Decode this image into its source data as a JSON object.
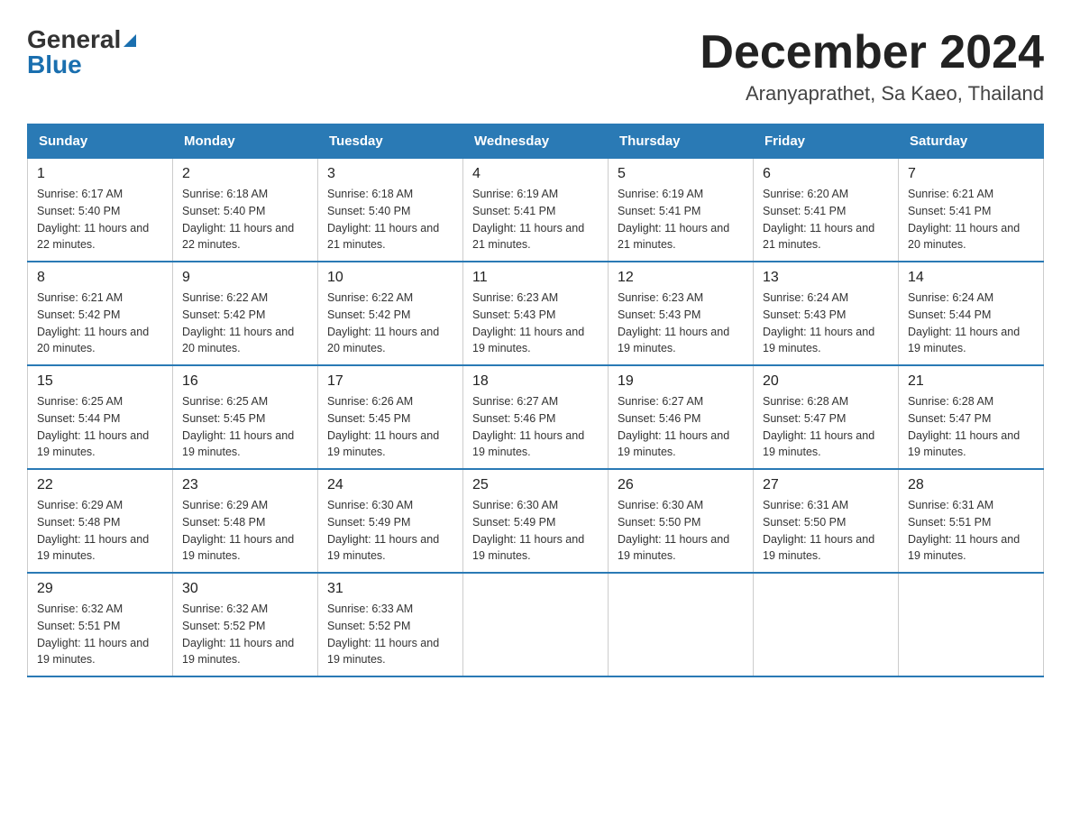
{
  "logo": {
    "general": "General",
    "blue": "Blue"
  },
  "header": {
    "title": "December 2024",
    "subtitle": "Aranyaprathet, Sa Kaeo, Thailand"
  },
  "days_of_week": [
    "Sunday",
    "Monday",
    "Tuesday",
    "Wednesday",
    "Thursday",
    "Friday",
    "Saturday"
  ],
  "weeks": [
    [
      {
        "day": "1",
        "sunrise": "6:17 AM",
        "sunset": "5:40 PM",
        "daylight": "11 hours and 22 minutes."
      },
      {
        "day": "2",
        "sunrise": "6:18 AM",
        "sunset": "5:40 PM",
        "daylight": "11 hours and 22 minutes."
      },
      {
        "day": "3",
        "sunrise": "6:18 AM",
        "sunset": "5:40 PM",
        "daylight": "11 hours and 21 minutes."
      },
      {
        "day": "4",
        "sunrise": "6:19 AM",
        "sunset": "5:41 PM",
        "daylight": "11 hours and 21 minutes."
      },
      {
        "day": "5",
        "sunrise": "6:19 AM",
        "sunset": "5:41 PM",
        "daylight": "11 hours and 21 minutes."
      },
      {
        "day": "6",
        "sunrise": "6:20 AM",
        "sunset": "5:41 PM",
        "daylight": "11 hours and 21 minutes."
      },
      {
        "day": "7",
        "sunrise": "6:21 AM",
        "sunset": "5:41 PM",
        "daylight": "11 hours and 20 minutes."
      }
    ],
    [
      {
        "day": "8",
        "sunrise": "6:21 AM",
        "sunset": "5:42 PM",
        "daylight": "11 hours and 20 minutes."
      },
      {
        "day": "9",
        "sunrise": "6:22 AM",
        "sunset": "5:42 PM",
        "daylight": "11 hours and 20 minutes."
      },
      {
        "day": "10",
        "sunrise": "6:22 AM",
        "sunset": "5:42 PM",
        "daylight": "11 hours and 20 minutes."
      },
      {
        "day": "11",
        "sunrise": "6:23 AM",
        "sunset": "5:43 PM",
        "daylight": "11 hours and 19 minutes."
      },
      {
        "day": "12",
        "sunrise": "6:23 AM",
        "sunset": "5:43 PM",
        "daylight": "11 hours and 19 minutes."
      },
      {
        "day": "13",
        "sunrise": "6:24 AM",
        "sunset": "5:43 PM",
        "daylight": "11 hours and 19 minutes."
      },
      {
        "day": "14",
        "sunrise": "6:24 AM",
        "sunset": "5:44 PM",
        "daylight": "11 hours and 19 minutes."
      }
    ],
    [
      {
        "day": "15",
        "sunrise": "6:25 AM",
        "sunset": "5:44 PM",
        "daylight": "11 hours and 19 minutes."
      },
      {
        "day": "16",
        "sunrise": "6:25 AM",
        "sunset": "5:45 PM",
        "daylight": "11 hours and 19 minutes."
      },
      {
        "day": "17",
        "sunrise": "6:26 AM",
        "sunset": "5:45 PM",
        "daylight": "11 hours and 19 minutes."
      },
      {
        "day": "18",
        "sunrise": "6:27 AM",
        "sunset": "5:46 PM",
        "daylight": "11 hours and 19 minutes."
      },
      {
        "day": "19",
        "sunrise": "6:27 AM",
        "sunset": "5:46 PM",
        "daylight": "11 hours and 19 minutes."
      },
      {
        "day": "20",
        "sunrise": "6:28 AM",
        "sunset": "5:47 PM",
        "daylight": "11 hours and 19 minutes."
      },
      {
        "day": "21",
        "sunrise": "6:28 AM",
        "sunset": "5:47 PM",
        "daylight": "11 hours and 19 minutes."
      }
    ],
    [
      {
        "day": "22",
        "sunrise": "6:29 AM",
        "sunset": "5:48 PM",
        "daylight": "11 hours and 19 minutes."
      },
      {
        "day": "23",
        "sunrise": "6:29 AM",
        "sunset": "5:48 PM",
        "daylight": "11 hours and 19 minutes."
      },
      {
        "day": "24",
        "sunrise": "6:30 AM",
        "sunset": "5:49 PM",
        "daylight": "11 hours and 19 minutes."
      },
      {
        "day": "25",
        "sunrise": "6:30 AM",
        "sunset": "5:49 PM",
        "daylight": "11 hours and 19 minutes."
      },
      {
        "day": "26",
        "sunrise": "6:30 AM",
        "sunset": "5:50 PM",
        "daylight": "11 hours and 19 minutes."
      },
      {
        "day": "27",
        "sunrise": "6:31 AM",
        "sunset": "5:50 PM",
        "daylight": "11 hours and 19 minutes."
      },
      {
        "day": "28",
        "sunrise": "6:31 AM",
        "sunset": "5:51 PM",
        "daylight": "11 hours and 19 minutes."
      }
    ],
    [
      {
        "day": "29",
        "sunrise": "6:32 AM",
        "sunset": "5:51 PM",
        "daylight": "11 hours and 19 minutes."
      },
      {
        "day": "30",
        "sunrise": "6:32 AM",
        "sunset": "5:52 PM",
        "daylight": "11 hours and 19 minutes."
      },
      {
        "day": "31",
        "sunrise": "6:33 AM",
        "sunset": "5:52 PM",
        "daylight": "11 hours and 19 minutes."
      },
      null,
      null,
      null,
      null
    ]
  ],
  "labels": {
    "sunrise": "Sunrise:",
    "sunset": "Sunset:",
    "daylight": "Daylight:"
  }
}
